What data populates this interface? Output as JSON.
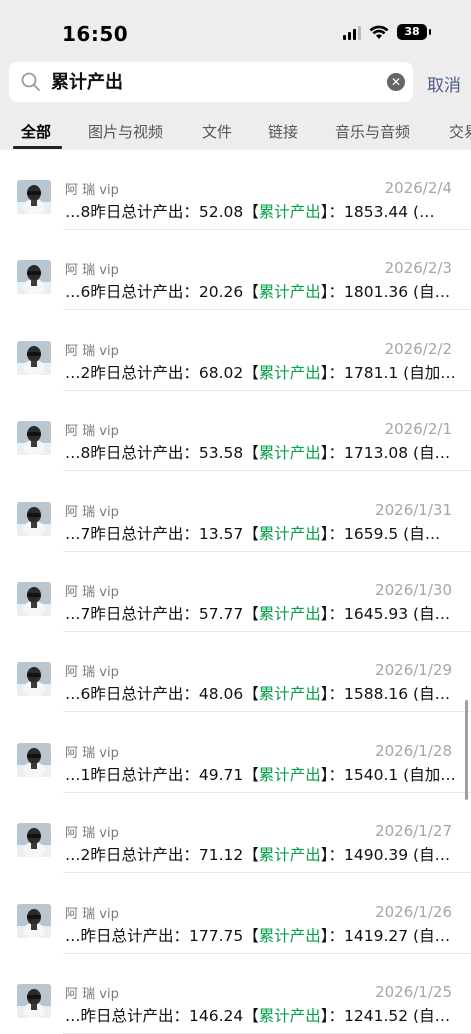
{
  "status": {
    "time": "16:50",
    "battery": "38"
  },
  "search": {
    "query": "累计产出",
    "cancel": "取消"
  },
  "tabs": [
    "全部",
    "图片与视频",
    "文件",
    "链接",
    "音乐与音频",
    "交易"
  ],
  "keyword": "累计产出",
  "results": [
    {
      "sender": "阿 瑞 vip",
      "date": "2026/2/4",
      "prefix": "…8昨日总计产出：52.08【",
      "suffix": "】：1853.44 (…"
    },
    {
      "sender": "阿 瑞 vip",
      "date": "2026/2/3",
      "prefix": "…6昨日总计产出：20.26【",
      "suffix": "】：1801.36 (自…"
    },
    {
      "sender": "阿 瑞 vip",
      "date": "2026/2/2",
      "prefix": "…2昨日总计产出：68.02【",
      "suffix": "】：1781.1 (自加…"
    },
    {
      "sender": "阿 瑞 vip",
      "date": "2026/2/1",
      "prefix": "…8昨日总计产出：53.58【",
      "suffix": "】：1713.08 (自…"
    },
    {
      "sender": "阿 瑞 vip",
      "date": "2026/1/31",
      "prefix": "…7昨日总计产出：13.57【",
      "suffix": "】：1659.5 (自…"
    },
    {
      "sender": "阿 瑞 vip",
      "date": "2026/1/30",
      "prefix": "…7昨日总计产出：57.77【",
      "suffix": "】：1645.93 (自…"
    },
    {
      "sender": "阿 瑞 vip",
      "date": "2026/1/29",
      "prefix": "…6昨日总计产出：48.06【",
      "suffix": "】：1588.16 (自…"
    },
    {
      "sender": "阿 瑞 vip",
      "date": "2026/1/28",
      "prefix": "…1昨日总计产出：49.71【",
      "suffix": "】：1540.1 (自加…"
    },
    {
      "sender": "阿 瑞 vip",
      "date": "2026/1/27",
      "prefix": "…2昨日总计产出：71.12【",
      "suffix": "】：1490.39 (自…"
    },
    {
      "sender": "阿 瑞 vip",
      "date": "2026/1/26",
      "prefix": "…昨日总计产出：177.75【",
      "suffix": "】：1419.27 (自…"
    },
    {
      "sender": "阿 瑞 vip",
      "date": "2026/1/25",
      "prefix": "…昨日总计产出：146.24【",
      "suffix": "】：1241.52 (自…"
    }
  ]
}
